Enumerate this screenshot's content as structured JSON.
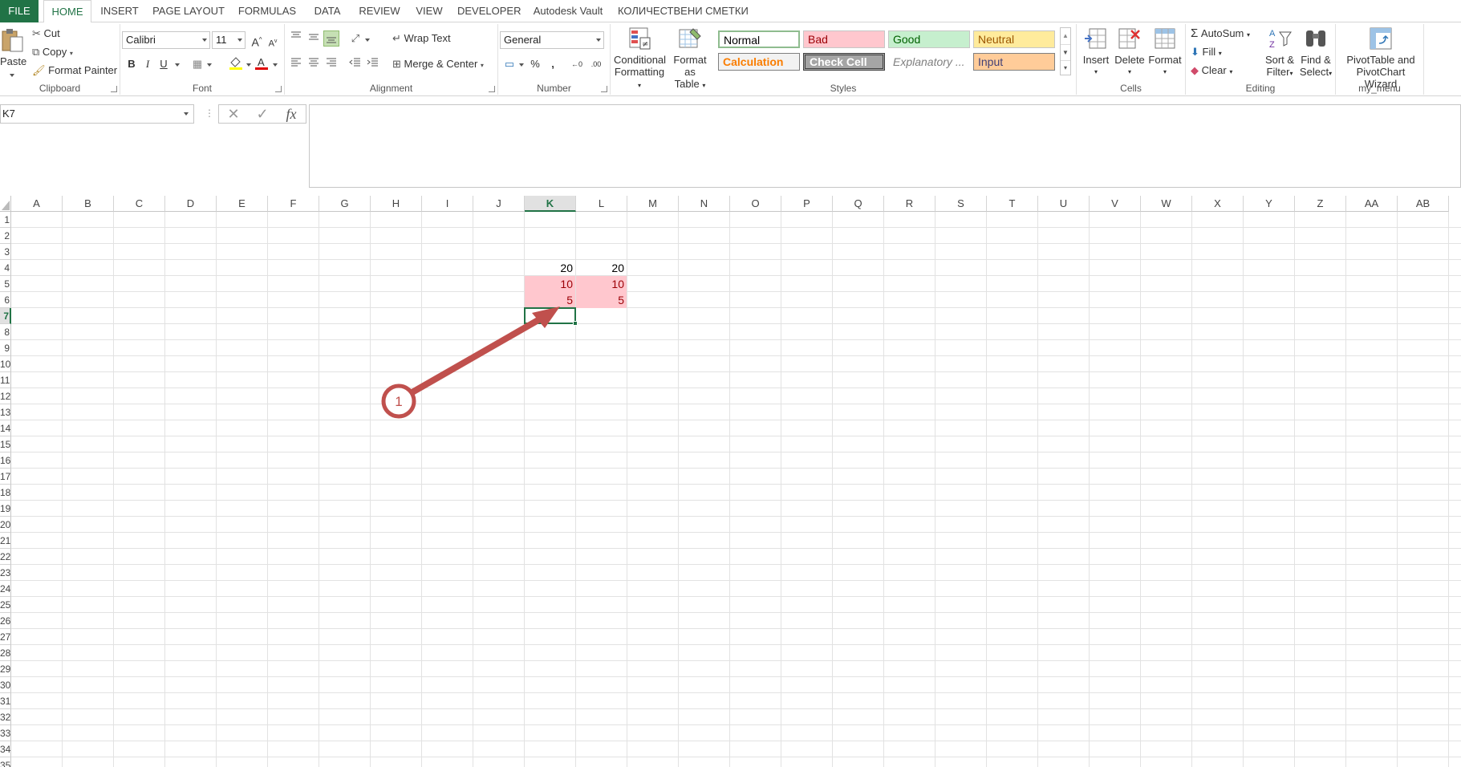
{
  "tabs": [
    {
      "label": "FILE"
    },
    {
      "label": "HOME"
    },
    {
      "label": "INSERT"
    },
    {
      "label": "PAGE LAYOUT"
    },
    {
      "label": "FORMULAS"
    },
    {
      "label": "DATA"
    },
    {
      "label": "REVIEW"
    },
    {
      "label": "VIEW"
    },
    {
      "label": "DEVELOPER"
    },
    {
      "label": "Autodesk Vault"
    },
    {
      "label": "КОЛИЧЕСТВЕНИ СМЕТКИ"
    }
  ],
  "clipboard": {
    "paste": "Paste",
    "cut": "Cut",
    "copy": "Copy",
    "format_painter": "Format Painter",
    "group": "Clipboard"
  },
  "font": {
    "name": "Calibri",
    "size": "11",
    "bold": "B",
    "italic": "I",
    "underline": "U",
    "group": "Font",
    "grow": "A",
    "shrink": "A"
  },
  "alignment": {
    "wrap_text": "Wrap Text",
    "merge_center": "Merge & Center",
    "group": "Alignment"
  },
  "number": {
    "format": "General",
    "percent": "%",
    "comma": ",",
    "group": "Number"
  },
  "styles": {
    "conditional_formatting_1": "Conditional",
    "conditional_formatting_2": "Formatting",
    "format_as_table_1": "Format as",
    "format_as_table_2": "Table",
    "normal": "Normal",
    "bad": "Bad",
    "good": "Good",
    "neutral": "Neutral",
    "calculation": "Calculation",
    "check_cell": "Check Cell",
    "explanatory": "Explanatory ...",
    "input": "Input",
    "group": "Styles"
  },
  "cells": {
    "insert": "Insert",
    "delete": "Delete",
    "format": "Format",
    "group": "Cells"
  },
  "editing": {
    "autosum": "AutoSum",
    "fill": "Fill",
    "clear": "Clear",
    "sort_filter_1": "Sort &",
    "sort_filter_2": "Filter",
    "find_select_1": "Find &",
    "find_select_2": "Select",
    "group": "Editing"
  },
  "my_menu": {
    "pivot_1": "PivotTable and",
    "pivot_2": "PivotChart Wizard",
    "group": "my_menu"
  },
  "formula_bar": {
    "name_box": "K7",
    "cancel": "✕",
    "enter": "✓",
    "fx": "fx",
    "formula": ""
  },
  "columns": [
    "A",
    "B",
    "C",
    "D",
    "E",
    "F",
    "G",
    "H",
    "I",
    "J",
    "K",
    "L",
    "M",
    "N",
    "O",
    "P",
    "Q",
    "R",
    "S",
    "T",
    "U",
    "V",
    "W",
    "X",
    "Y",
    "Z",
    "AA",
    "AB"
  ],
  "rows": [
    "1",
    "2",
    "3",
    "4",
    "5",
    "6",
    "7",
    "8",
    "9",
    "10",
    "11",
    "12",
    "13",
    "14",
    "15",
    "16",
    "17",
    "18",
    "19",
    "20",
    "21",
    "22",
    "23",
    "24",
    "25",
    "26",
    "27",
    "28",
    "29",
    "30",
    "31",
    "32",
    "33",
    "34",
    "35"
  ],
  "selected": {
    "column": "K",
    "row": "7"
  },
  "cell_values": {
    "K4": "20",
    "L4": "20",
    "K5": "10",
    "L5": "10",
    "K6": "5",
    "L6": "5"
  },
  "annotation": {
    "label": "1",
    "color": "#c0504d"
  },
  "colors": {
    "accent": "#217346",
    "bad_fill": "#ffc7ce",
    "bad_text": "#9c0006"
  }
}
